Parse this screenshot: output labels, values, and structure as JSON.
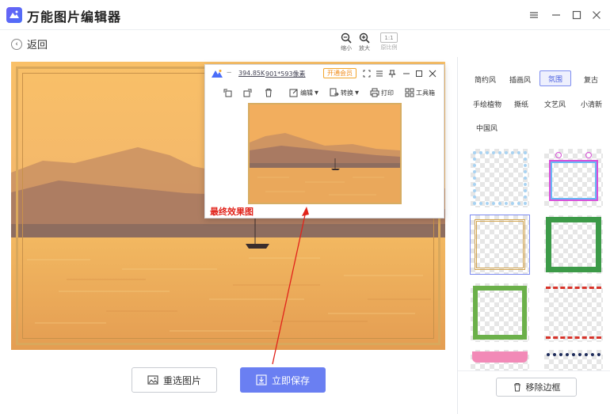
{
  "app": {
    "title": "万能图片编辑器"
  },
  "toolbar": {
    "back_label": "返回",
    "zoom_out_label": "缩小",
    "zoom_in_label": "放大",
    "ratio_text": "1:1",
    "ratio_label": "原比例"
  },
  "popup": {
    "file_size": "394.85K",
    "dimensions": "901*593像素",
    "vip_label": "开通会员",
    "edit_label": "编辑",
    "convert_label": "转换",
    "print_label": "打印",
    "toolbox_label": "工具箱"
  },
  "annotation": {
    "final_label": "最终效果图"
  },
  "buttons": {
    "reselect_label": "重选图片",
    "save_label": "立即保存",
    "remove_label": "移除边框"
  },
  "categories": [
    {
      "label": "简约风",
      "active": false
    },
    {
      "label": "插画风",
      "active": false
    },
    {
      "label": "氛围",
      "active": true
    },
    {
      "label": "复古",
      "active": false
    },
    {
      "label": "手绘植物",
      "active": false
    },
    {
      "label": "撕纸",
      "active": false
    },
    {
      "label": "文艺风",
      "active": false
    },
    {
      "label": "小清新",
      "active": false
    },
    {
      "label": "中国风",
      "active": false
    }
  ],
  "colors": {
    "accent": "#6a7ff2",
    "annotation_red": "#e1231b",
    "vip_orange": "#f08c1a"
  }
}
